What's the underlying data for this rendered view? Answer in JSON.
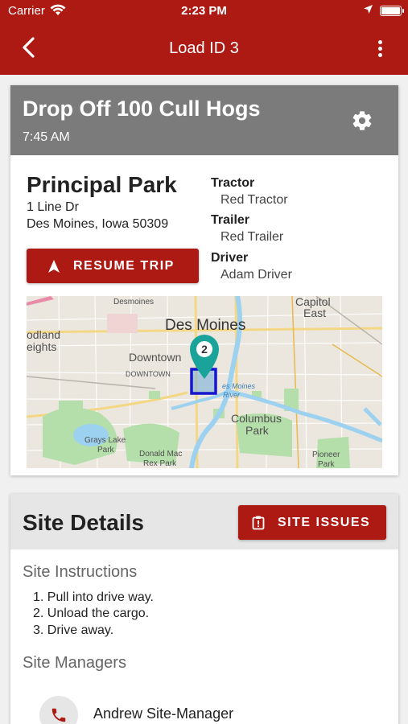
{
  "status_bar": {
    "carrier": "Carrier",
    "time": "2:23 PM"
  },
  "nav": {
    "title": "Load ID 3"
  },
  "load": {
    "title": "Drop Off 100 Cull Hogs",
    "time": "7:45 AM",
    "location_name": "Principal Park",
    "address_line1": "1 Line Dr",
    "address_line2": "Des Moines, Iowa 50309",
    "tractor_label": "Tractor",
    "tractor_value": "Red Tractor",
    "trailer_label": "Trailer",
    "trailer_value": "Red Trailer",
    "driver_label": "Driver",
    "driver_value": "Adam Driver",
    "resume_button": "RESUME TRIP"
  },
  "map": {
    "labels": {
      "desmoines_small": "Desmoines",
      "des_moines": "Des Moines",
      "capitol": "Capitol",
      "east": "East",
      "odland": "odland",
      "eights": "eights",
      "downtown": "Downtown",
      "downtown_caps": "DOWNTOWN",
      "river1": "es Moines",
      "river2": "River",
      "columbus": "Columbus",
      "park": "Park",
      "grays_lake": "Grays Lake",
      "grays_park": "Park",
      "donald_mac": "Donald Mac",
      "rex_park": "Rex Park",
      "pioneer": "Pioneer",
      "pioneer_park": "Park"
    },
    "marker_number": "2",
    "marker_color": "#1aa39a"
  },
  "site": {
    "title": "Site Details",
    "issues_button": "SITE ISSUES",
    "instructions_title": "Site Instructions",
    "instructions": [
      "1. Pull into drive way.",
      "2. Unload the cargo.",
      "3. Drive away."
    ],
    "managers_title": "Site Managers",
    "manager_name": "Andrew Site-Manager"
  },
  "colors": {
    "primary": "#ad1a14",
    "header_gray": "#7b7b7b"
  }
}
